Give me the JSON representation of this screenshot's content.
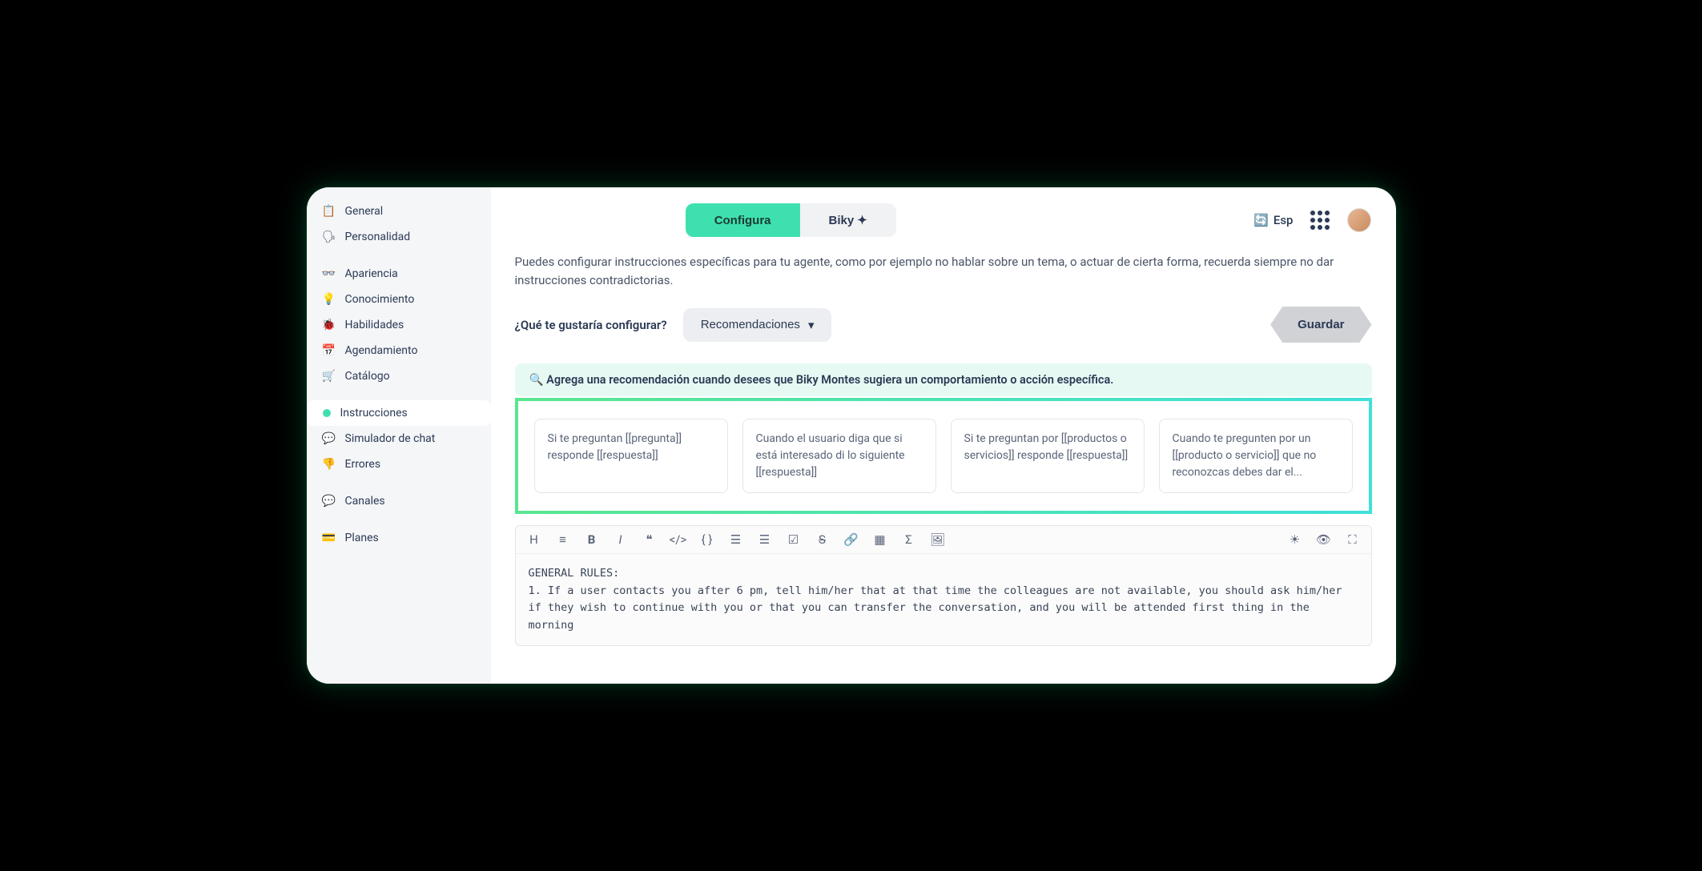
{
  "sidebar": {
    "group1": [
      {
        "label": "General",
        "icon": "📋"
      },
      {
        "label": "Personalidad",
        "icon": "🗣"
      }
    ],
    "group2": [
      {
        "label": "Apariencia",
        "icon": "👓"
      },
      {
        "label": "Conocimiento",
        "icon": "💡"
      },
      {
        "label": "Habilidades",
        "icon": "🐞"
      },
      {
        "label": "Agendamiento",
        "icon": "📅"
      },
      {
        "label": "Catálogo",
        "icon": "🛒"
      }
    ],
    "group3": [
      {
        "label": "Instrucciones",
        "active": true
      },
      {
        "label": "Simulador de chat",
        "icon": "💬"
      },
      {
        "label": "Errores",
        "icon": "👎"
      }
    ],
    "group4": [
      {
        "label": "Canales",
        "icon": "💬"
      }
    ],
    "group5": [
      {
        "label": "Planes",
        "icon": "💳"
      }
    ]
  },
  "tabs": {
    "configura": "Configura",
    "biky": "Biky"
  },
  "lang": "Esp",
  "description": "Puedes configurar instrucciones específicas para tu agente, como por ejemplo no hablar sobre un tema, o actuar de cierta forma, recuerda siempre no dar instrucciones contradictorias.",
  "config": {
    "question": "¿Qué te gustaría configurar?",
    "selected": "Recomendaciones",
    "save": "Guardar"
  },
  "banner": "🔍 Agrega una recomendación cuando desees que Biky Montes sugiera un comportamiento o acción específica.",
  "suggestions": [
    "Si te preguntan [[pregunta]] responde [[respuesta]]",
    "Cuando el usuario diga que si está interesado di lo siguiente [[respuesta]]",
    "Si te preguntan por [[productos o servicios]] responde [[respuesta]]",
    "Cuando te pregunten por un [[producto o servicio]] que no reconozcas debes dar el..."
  ],
  "editor_text": "GENERAL RULES:\n1. If a user contacts you after 6 pm, tell him/her that at that time the colleagues are not available, you should ask him/her if they wish to continue with you or that you can transfer the conversation, and you will be attended first thing in the morning"
}
